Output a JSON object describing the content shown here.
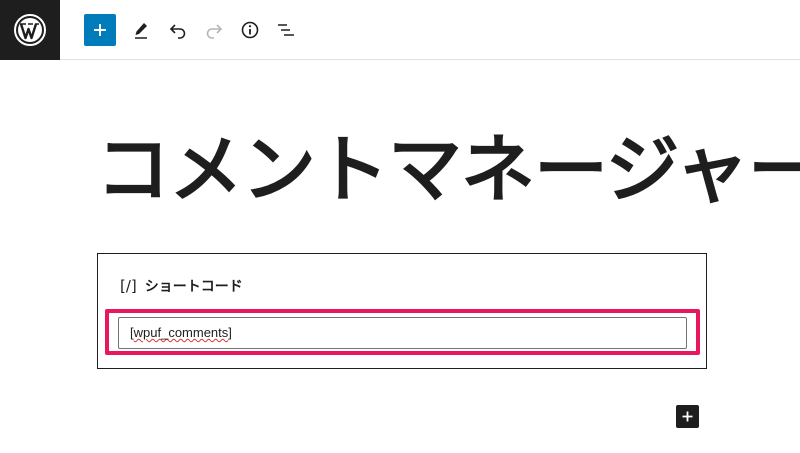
{
  "toolbar": {
    "logo_icon": "wordpress-logo-icon",
    "add_block_icon": "plus-icon",
    "tools_icon": "pencil-icon",
    "undo_icon": "undo-icon",
    "redo_icon": "redo-icon",
    "details_icon": "info-icon",
    "list_view_icon": "list-view-icon",
    "accent_color": "#007cba"
  },
  "post": {
    "title": "コメントマネージャー"
  },
  "shortcode_block": {
    "icon_text": "[/]",
    "label": "ショートコード",
    "value_prefix": "[",
    "value_word": "wpuf_comments",
    "value_suffix": "]",
    "highlight_color": "#e8175d"
  },
  "inserter": {
    "icon": "plus-icon"
  }
}
